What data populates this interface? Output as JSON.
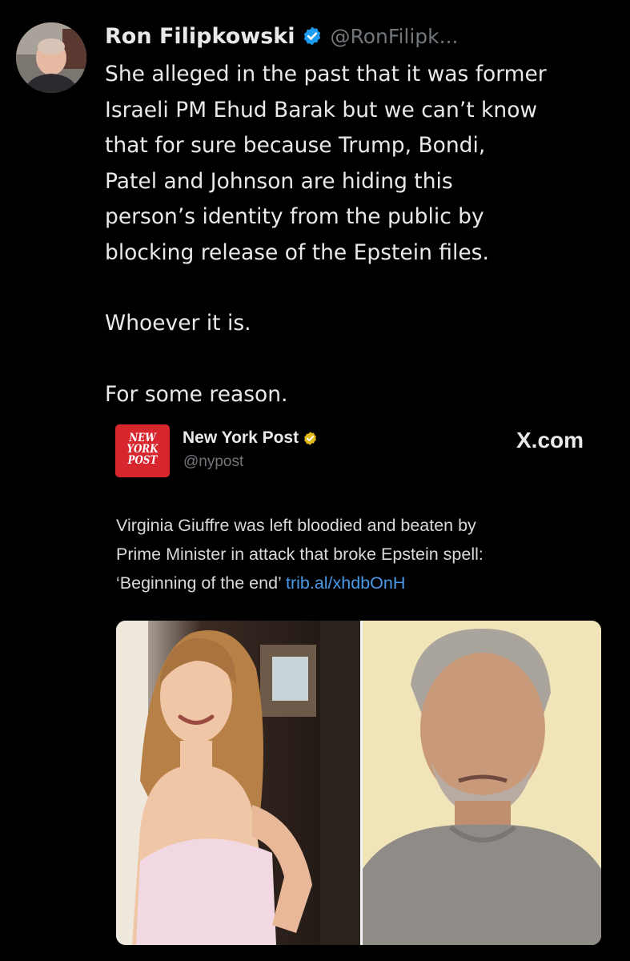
{
  "post": {
    "author_name": "Ron Filipkowski",
    "handle": "@RonFilipk...",
    "lines": [
      "She alleged in the past that it was former",
      "Israeli PM Ehud Barak but we can’t know",
      "that for sure because Trump, Bondi,",
      "Patel and Johnson are hiding this",
      "person’s identity from the public by",
      "blocking release of the Epstein files."
    ],
    "paragraph_2": "Whoever it is.",
    "paragraph_3": "For some reason."
  },
  "quoted": {
    "logo_lines": [
      "NEW",
      "YORK",
      "POST"
    ],
    "name": "New York Post",
    "handle": "@nypost",
    "source_label": "X.com",
    "text_lines": [
      "Virginia Giuffre was left bloodied and beaten by",
      "Prime Minister in attack that broke Epstein spell:",
      "‘Beginning of the end’ "
    ],
    "link_text": "trib.al/xhdbOnH"
  },
  "icons": {
    "verified_blue": "verified-badge-icon",
    "verified_gold": "verified-org-badge-icon"
  },
  "colors": {
    "background": "#000000",
    "text": "#e7e9ea",
    "muted": "#71767b",
    "link": "#4a99e9",
    "verified_blue": "#1d9bf0",
    "verified_gold": "#e2b719",
    "nypost_red": "#d8262f"
  }
}
